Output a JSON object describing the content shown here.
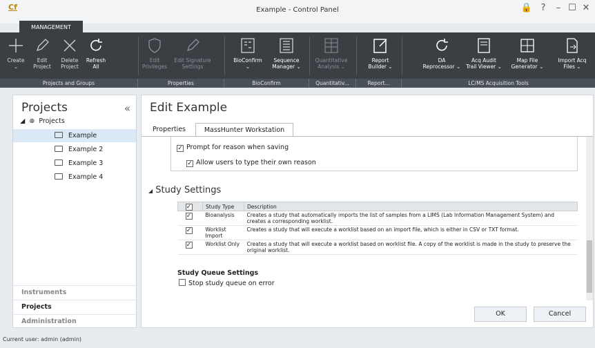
{
  "window": {
    "logo": "Cf",
    "title": "Example - Control Panel",
    "controls": [
      "🔒",
      "?",
      "–",
      "☐",
      "✕"
    ]
  },
  "ribbon_tab": "MANAGEMENT",
  "ribbon": {
    "buttons": [
      {
        "label": "Create",
        "sub": "⌄",
        "icon": "plus-icon"
      },
      {
        "label": "Edit",
        "sub": "Project",
        "icon": "pencil-icon"
      },
      {
        "label": "Delete",
        "sub": "Project",
        "icon": "x-icon"
      },
      {
        "label": "Refresh",
        "sub": "All",
        "icon": "refresh-icon"
      },
      {
        "label": "Edit",
        "sub": "Privileges",
        "icon": "shield-icon"
      },
      {
        "label": "Edit Signature",
        "sub": "Settings",
        "icon": "pencil-icon"
      },
      {
        "label": "BioConfirm",
        "sub": "⌄",
        "icon": "bioconfirm-icon"
      },
      {
        "label": "Sequence",
        "sub": "Manager ⌄",
        "icon": "sequence-icon"
      },
      {
        "label": "Quantitative",
        "sub": "Analysis ⌄",
        "icon": "quant-icon"
      },
      {
        "label": "Report",
        "sub": "Builder ⌄",
        "icon": "report-icon"
      },
      {
        "label": "DA",
        "sub": "Reprocessor ⌄",
        "icon": "reprocess-icon"
      },
      {
        "label": "Acq Audit",
        "sub": "Trail Viewer ⌄",
        "icon": "audit-icon"
      },
      {
        "label": "Map File",
        "sub": "Generator ⌄",
        "icon": "map-icon"
      },
      {
        "label": "Import Acq",
        "sub": "Files ⌄",
        "icon": "import-icon"
      }
    ],
    "groups": [
      "Projects and Groups",
      "Properties",
      "BioConfirm",
      "Quantitativ...",
      "Report...",
      "LC/MS Acquisition Tools"
    ]
  },
  "left": {
    "title": "Projects",
    "collapse": "«",
    "root": "Projects",
    "items": [
      "Example",
      "Example 2",
      "Example 3",
      "Example 4"
    ],
    "sections": [
      "Instruments",
      "Projects",
      "Administration"
    ]
  },
  "main": {
    "title": "Edit Example",
    "tabs": [
      "Properties",
      "MassHunter Workstation"
    ],
    "opt_reason": "Prompt for reason when saving",
    "opt_allow": "Allow users to type their own reason",
    "study_title": "Study Settings",
    "table": {
      "headers": [
        "",
        "Study Type",
        "Description"
      ],
      "rows": [
        {
          "type": "Bioanalysis",
          "desc": "Creates a study that automatically imports the list of samples from a LIMS (Lab Information Management System) and creates a corresponding worklist."
        },
        {
          "type": "Worklist Import",
          "desc": "Creates a study that will execute a worklist based on an import file, which is either in CSV or TXT format."
        },
        {
          "type": "Worklist Only",
          "desc": "Creates a study that will execute a worklist based on worklist file. A copy of the worklist is made in the study to preserve the original worklist."
        }
      ]
    },
    "queue_title": "Study Queue Settings",
    "queue_opt": "Stop study queue on error",
    "ok": "OK",
    "cancel": "Cancel"
  },
  "status": "Current user: admin (admin)"
}
